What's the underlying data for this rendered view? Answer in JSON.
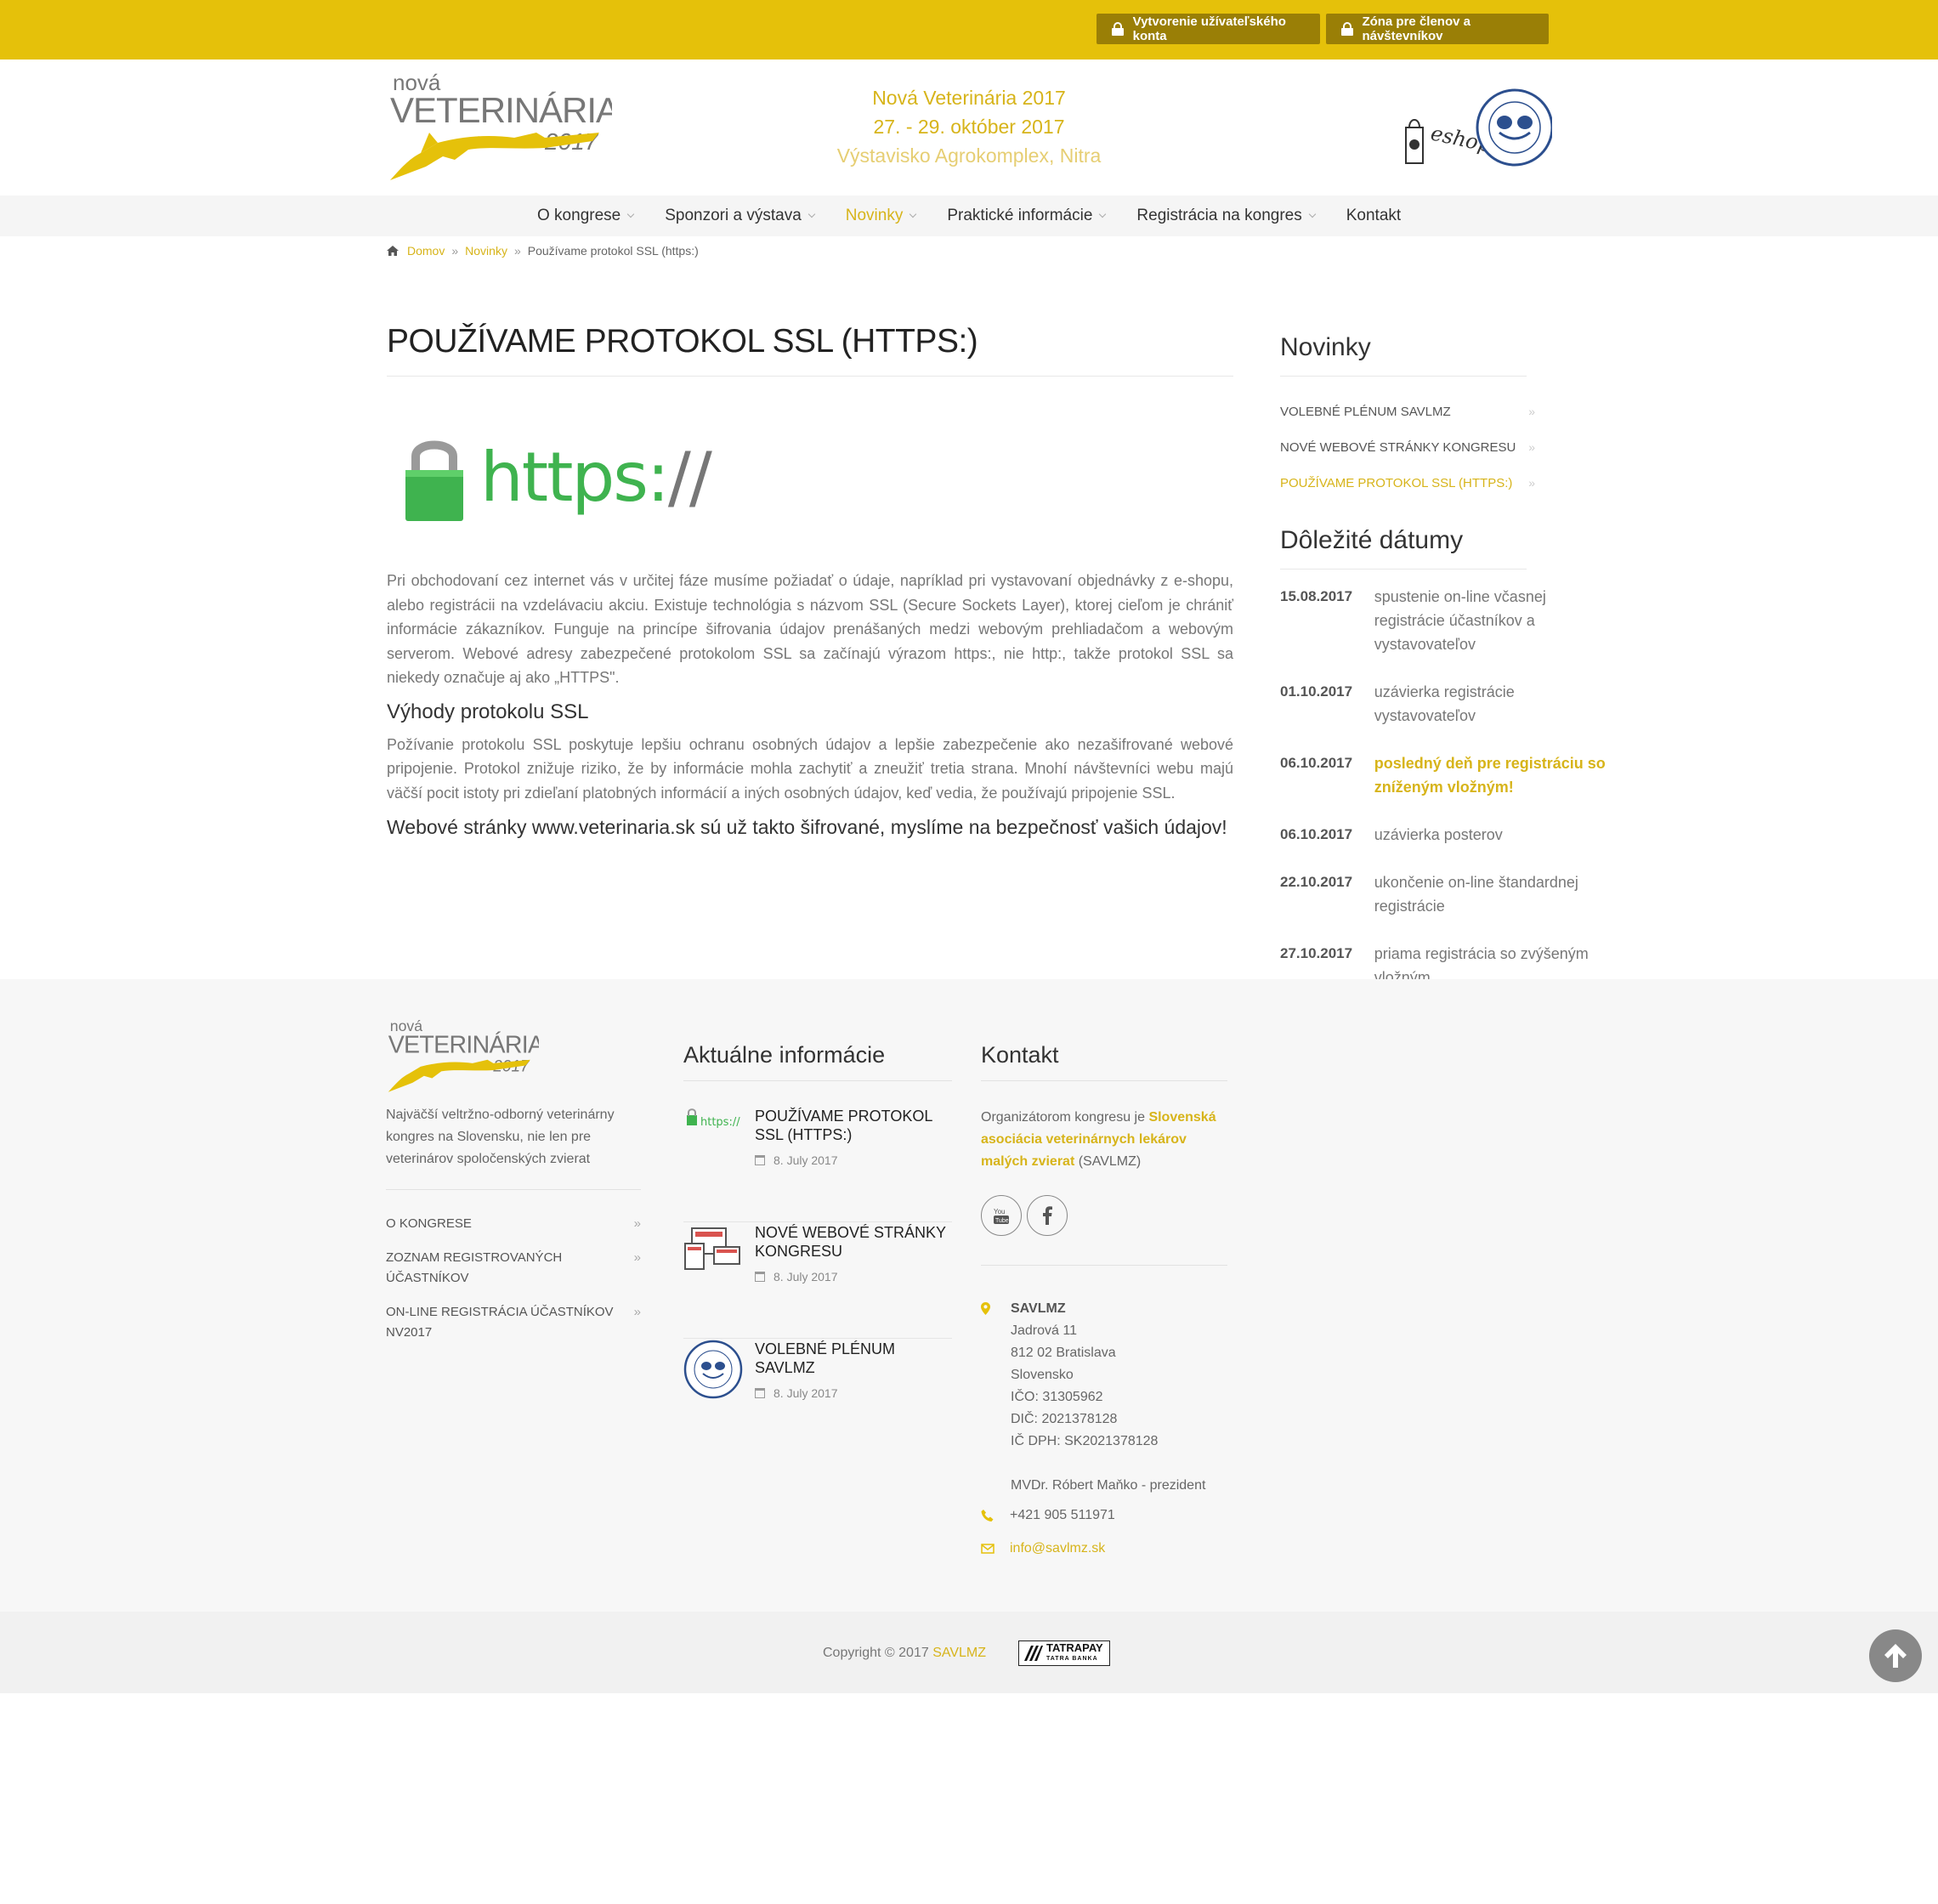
{
  "topbar": {
    "btn_register": "Vytvorenie užívateľského konta",
    "btn_zone": "Zóna pre členov a návštevníkov"
  },
  "header": {
    "logo": {
      "line1": "nová",
      "line2": "VETERINÁRIA",
      "line3": "2017"
    },
    "event_title": "Nová Veterinária 2017",
    "event_dates": "27. - 29. október 2017",
    "event_location": "Výstavisko Agrokomplex, Nitra",
    "eshop_label": "eshop"
  },
  "nav": {
    "items": [
      {
        "label": "O kongrese",
        "dropdown": true
      },
      {
        "label": "Sponzori a výstava",
        "dropdown": true
      },
      {
        "label": "Novinky",
        "dropdown": true,
        "active": true
      },
      {
        "label": "Praktické informácie",
        "dropdown": true
      },
      {
        "label": "Registrácia na kongres",
        "dropdown": true
      },
      {
        "label": "Kontakt",
        "dropdown": false
      }
    ]
  },
  "breadcrumb": {
    "home": "Domov",
    "section": "Novinky",
    "current": "Používame protokol SSL (https:)",
    "sep": "»"
  },
  "article": {
    "title": "POUŽÍVAME PROTOKOL SSL (HTTPS:)",
    "image_text_a": "https:",
    "image_text_b": "//",
    "p1": "Pri obchodovaní cez internet vás v určitej fáze musíme požiadať o údaje, napríklad pri vystavovaní objednávky z e-shopu, alebo registrácii na vzdelávaciu akciu. Existuje technológia s názvom SSL (Secure Sockets Layer), ktorej cieľom je chrániť informácie zákazníkov. Funguje na princípe šifrovania údajov prenášaných medzi webovým prehliadačom a webovým serverom. Webové adresy zabezpečené protokolom SSL sa začínajú výrazom https:, nie http:, takže protokol SSL sa niekedy označuje aj ako „HTTPS\".",
    "h3": "Výhody protokolu SSL",
    "p2": "Požívanie protokolu SSL poskytuje lepšiu ochranu osobných údajov a lepšie zabezpečenie ako nezašifrované webové pripojenie. Protokol znižuje riziko, že by informácie mohla zachytiť a zneužiť tretia strana. Mnohí návštevníci webu majú väčší pocit istoty pri zdieľaní platobných informácií a iných osobných údajov, keď vedia, že používajú pripojenie SSL.",
    "p3": "Webové stránky www.veterinaria.sk sú už takto šifrované, myslíme na bezpečnosť vašich údajov!"
  },
  "sidebar": {
    "news_heading": "Novinky",
    "news": [
      {
        "label": "VOLEBNÉ PLÉNUM SAVLMZ"
      },
      {
        "label": "NOVÉ WEBOVÉ STRÁNKY KONGRESU"
      },
      {
        "label": "POUŽÍVAME PROTOKOL SSL (HTTPS:)",
        "active": true
      }
    ],
    "arrow": "»",
    "dates_heading": "Dôležité dátumy",
    "dates": [
      {
        "date": "15.08.2017",
        "text": "spustenie on-line včasnej registrácie účastníkov a vystavovateľov"
      },
      {
        "date": "01.10.2017",
        "text": "uzávierka registrácie vystavovateľov"
      },
      {
        "date": "06.10.2017",
        "text": "posledný deň pre registráciu so zníženým vložným!",
        "highlight": true
      },
      {
        "date": "06.10.2017",
        "text": "uzávierka posterov"
      },
      {
        "date": "22.10.2017",
        "text": "ukončenie on-line štandardnej registrácie"
      },
      {
        "date": "27.10.2017",
        "text": "priama registrácia so zvýšeným vložným"
      }
    ]
  },
  "footer": {
    "description": "Najväčší veltržno-odborný veterinárny kongres na Slovensku, nie len pre veterinárov spoločenských zvierat",
    "links": [
      {
        "label": "O KONGRESE"
      },
      {
        "label": "ZOZNAM REGISTROVANÝCH ÚČASTNÍKOV"
      },
      {
        "label": "ON-LINE REGISTRÁCIA ÚČASTNÍKOV NV2017"
      }
    ],
    "news_heading": "Aktuálne informácie",
    "news": [
      {
        "title": "POUŽÍVAME PROTOKOL SSL (HTTPS:)",
        "date": "8. July 2017",
        "thumb_text": "https://"
      },
      {
        "title": "NOVÉ WEBOVÉ STRÁNKY KONGRESU",
        "date": "8. July 2017"
      },
      {
        "title": "VOLEBNÉ PLÉNUM SAVLMZ",
        "date": "8. July 2017"
      }
    ],
    "contact_heading": "Kontakt",
    "contact_pre": "Organizátorom kongresu je ",
    "contact_org": "Slovenská asociácia veterinárnych lekárov malých zvierat",
    "contact_post": " (SAVLMZ)",
    "address": {
      "name": "SAVLMZ",
      "street": "Jadrová 11",
      "city": "812 02 Bratislava",
      "country": "Slovensko",
      "ico": "IČO: 31305962",
      "dic": "DIČ: 2021378128",
      "icdph": "IČ DPH: SK2021378128",
      "president": "MVDr. Róbert Maňko - prezident"
    },
    "phone": "+421 905 511971",
    "email": "info@savlmz.sk",
    "copyright_pre": "Copyright © 2017 ",
    "copyright_brand": "SAVLMZ",
    "tatrapay": "TATRAPAY",
    "tatrabanka": "TATRA BANKA"
  },
  "colors": {
    "accent": "#e5c10a",
    "accent_text": "#d7b41a",
    "dark_button": "#9a7f06"
  }
}
